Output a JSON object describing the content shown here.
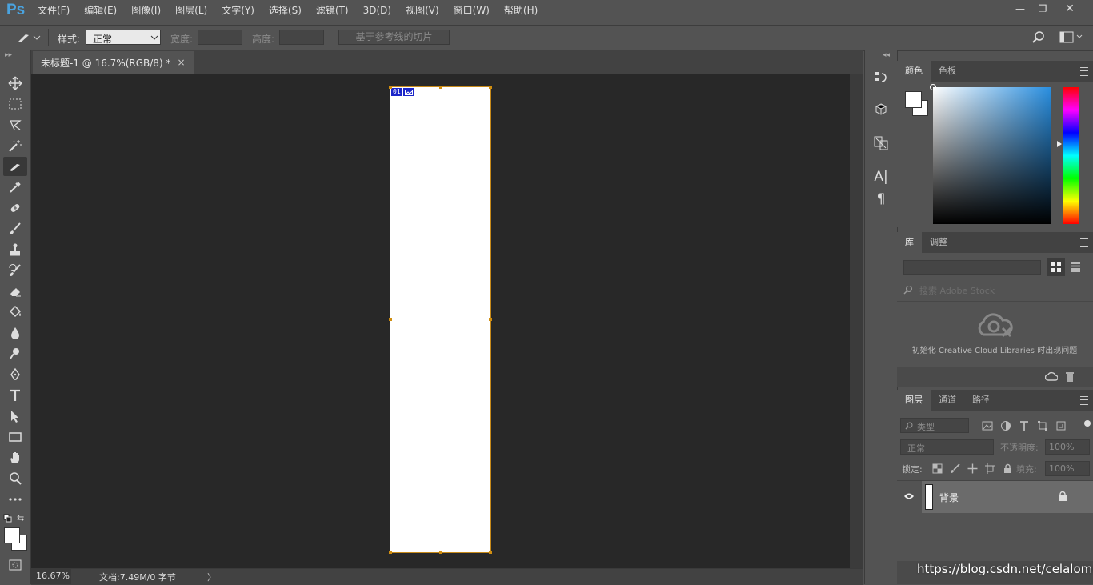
{
  "app": {
    "logo": "Ps"
  },
  "menu": [
    "文件(F)",
    "编辑(E)",
    "图像(I)",
    "图层(L)",
    "文字(Y)",
    "选择(S)",
    "滤镜(T)",
    "3D(D)",
    "视图(V)",
    "窗口(W)",
    "帮助(H)"
  ],
  "window_controls": {
    "minimize": "—",
    "restore": "❐",
    "close": "✕"
  },
  "options": {
    "style_label": "样式:",
    "style_value": "正常",
    "width_label": "宽度:",
    "height_label": "高度:",
    "slice_button": "基于参考线的切片"
  },
  "document": {
    "tab_title": "未标题-1 @ 16.7%(RGB/8) *",
    "tab_close": "×",
    "slice_number": "01",
    "zoom": "16.67%",
    "doc_info": "文档:7.49M/0 字节",
    "status_arrow": "〉"
  },
  "tools": [
    "move-tool",
    "marquee-tool",
    "lasso-tool",
    "magic-wand-tool",
    "slice-tool",
    "eyedropper-tool",
    "healing-brush-tool",
    "brush-tool",
    "clone-stamp-tool",
    "history-brush-tool",
    "eraser-tool",
    "paint-bucket-tool",
    "blur-tool",
    "dodge-tool",
    "pen-tool",
    "type-tool",
    "path-selection-tool",
    "rectangle-tool",
    "hand-tool",
    "zoom-tool",
    "more-tools"
  ],
  "active_tool": "slice-tool",
  "color_panel": {
    "tabs": [
      "颜色",
      "色板"
    ],
    "foreground": "#ffffff",
    "background": "#ffffff",
    "picker_hue": "#2a8fe0"
  },
  "library_panel": {
    "tabs": [
      "库",
      "调整"
    ],
    "search_placeholder": "搜索 Adobe Stock",
    "message": "初始化 Creative Cloud Libraries 时出现问题"
  },
  "layers_panel": {
    "tabs": [
      "图层",
      "通道",
      "路径"
    ],
    "filter_placeholder": "类型",
    "blend_mode": "正常",
    "opacity_label": "不透明度:",
    "opacity_value": "100%",
    "lock_label": "锁定:",
    "fill_label": "填充:",
    "fill_value": "100%",
    "layers": [
      {
        "name": "背景",
        "visible": true,
        "locked": true
      }
    ]
  },
  "watermark": "https://blog.csdn.net/celalomo",
  "dock_text_icon": "A|",
  "dock_para_icon": "¶"
}
